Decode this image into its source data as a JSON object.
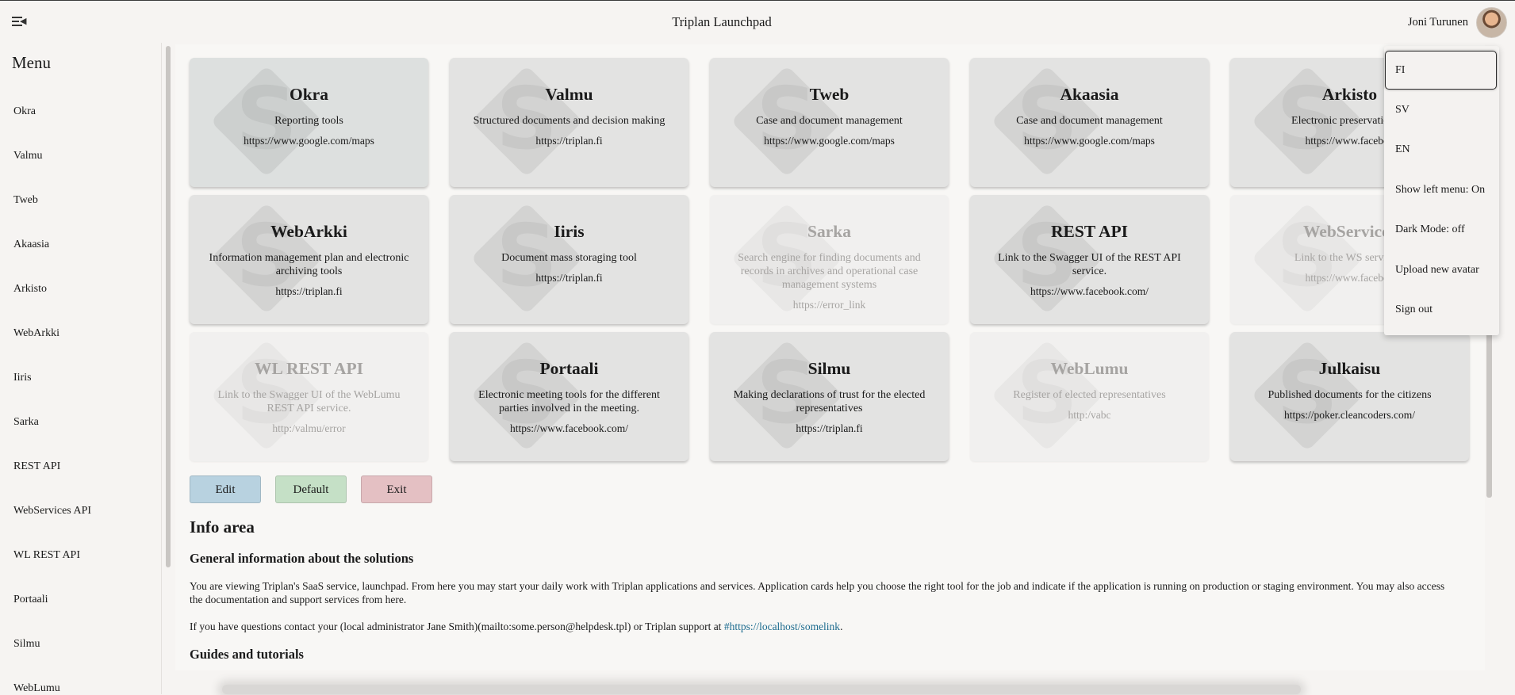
{
  "header": {
    "title": "Triplan Launchpad",
    "user_name": "Joni Turunen"
  },
  "sidebar": {
    "heading": "Menu",
    "items": [
      "Okra",
      "Valmu",
      "Tweb",
      "Akaasia",
      "Arkisto",
      "WebArkki",
      "Iiris",
      "Sarka",
      "REST API",
      "WebServices API",
      "WL REST API",
      "Portaali",
      "Silmu",
      "WebLumu"
    ]
  },
  "cards": [
    {
      "title": "Okra",
      "desc": "Reporting tools",
      "url": "https://www.google.com/maps",
      "enabled": true
    },
    {
      "title": "Valmu",
      "desc": "Structured documents and decision making",
      "url": "https://triplan.fi",
      "enabled": true
    },
    {
      "title": "Tweb",
      "desc": "Case and document management",
      "url": "https://www.google.com/maps",
      "enabled": true
    },
    {
      "title": "Akaasia",
      "desc": "Case and document management",
      "url": "https://www.google.com/maps",
      "enabled": true
    },
    {
      "title": "Arkisto",
      "desc": "Electronic preservation an",
      "url": "https://www.faceboo",
      "enabled": true
    },
    {
      "title": "WebArkki",
      "desc": "Information management plan and electronic archiving tools",
      "url": "https://triplan.fi",
      "enabled": true
    },
    {
      "title": "Iiris",
      "desc": "Document mass storaging tool",
      "url": "https://triplan.fi",
      "enabled": true
    },
    {
      "title": "Sarka",
      "desc": "Search engine for finding documents and records in archives and operational case management systems",
      "url": "https://error_link",
      "enabled": false
    },
    {
      "title": "REST API",
      "desc": "Link to the Swagger UI of the REST API service.",
      "url": "https://www.facebook.com/",
      "enabled": true
    },
    {
      "title": "WebServices",
      "desc": "Link to the WS service d",
      "url": "https://www.faceboo",
      "enabled": false
    },
    {
      "title": "WL REST API",
      "desc": "Link to the Swagger UI of the WebLumu REST API service.",
      "url": "http:/valmu/error",
      "enabled": false
    },
    {
      "title": "Portaali",
      "desc": "Electronic meeting tools for the different parties involved in the meeting.",
      "url": "https://www.facebook.com/",
      "enabled": true
    },
    {
      "title": "Silmu",
      "desc": "Making declarations of trust for the elected representatives",
      "url": "https://triplan.fi",
      "enabled": true
    },
    {
      "title": "WebLumu",
      "desc": "Register of elected representatives",
      "url": "http:/vabc",
      "enabled": false
    },
    {
      "title": "Julkaisu",
      "desc": "Published documents for the citizens",
      "url": "https://poker.cleancoders.com/",
      "enabled": true
    }
  ],
  "buttons": {
    "edit": "Edit",
    "default": "Default",
    "exit": "Exit"
  },
  "info": {
    "title": "Info area",
    "subtitle": "General information about the solutions",
    "paragraph1": "You are viewing Triplan's SaaS service, launchpad. From here you may start your daily work with Triplan applications and services. Application cards help you choose the right tool for the job and indicate if the application is running on production or staging environment. You may also access the documentation and support services from here.",
    "paragraph2_text": "If you have questions contact your (local administrator Jane Smith)(mailto:some.person@helpdesk.tpl) or Triplan support at ",
    "paragraph2_link": "#https://localhost/somelink",
    "paragraph2_end": ".",
    "guides_title": "Guides and tutorials"
  },
  "dropdown": {
    "items": [
      "FI",
      "SV",
      "EN",
      "Show left menu: On",
      "Dark Mode: off",
      "Upload new avatar",
      "Sign out"
    ],
    "selected": "FI"
  },
  "colors": {
    "edit_button": "#b8d2e0",
    "default_button": "#c5e0c6",
    "exit_button": "#e4c0c3",
    "link": "#1c6b8e",
    "card_bg": "#e3e3e2",
    "card_disabled_bg": "#f1f0ef"
  },
  "icons": {
    "menu_toggle": "menu-collapse-icon",
    "card_logo": "triplan-logo-icon"
  }
}
